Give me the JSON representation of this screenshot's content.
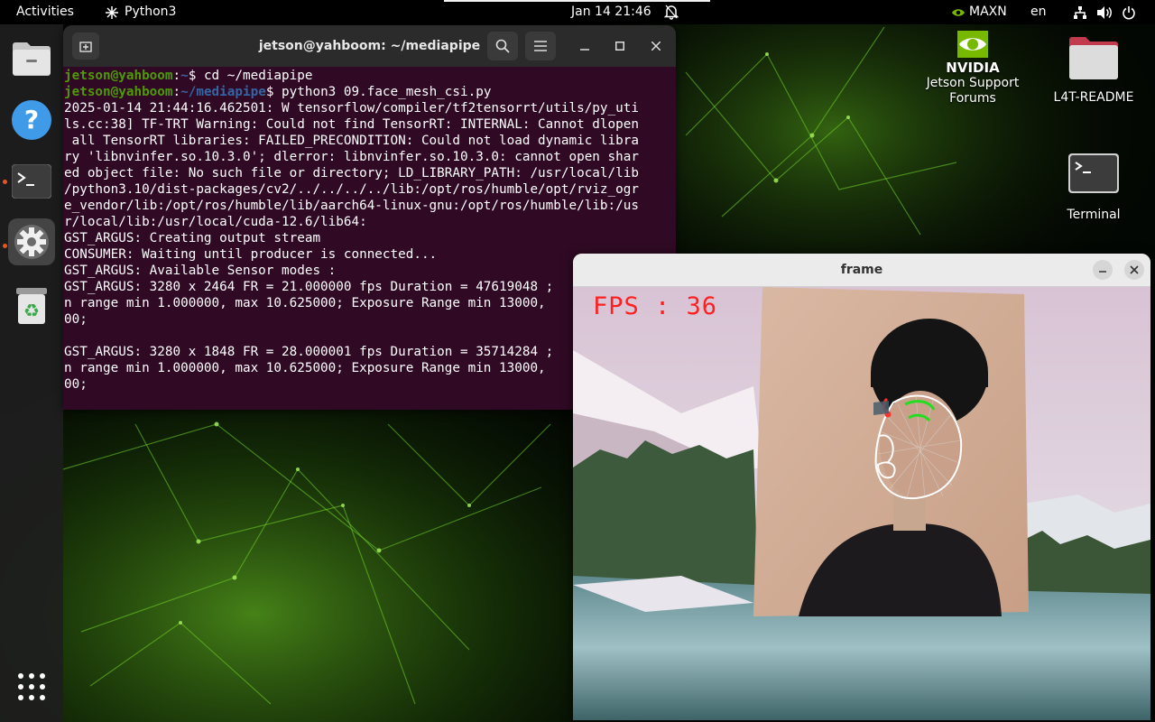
{
  "topbar": {
    "activities": "Activities",
    "app_name": "Python3",
    "clock": "Jan 14  21:46",
    "power_mode": "MAXN",
    "language": "en"
  },
  "dock": {
    "items": [
      {
        "name": "files",
        "icon": "folder-icon"
      },
      {
        "name": "help",
        "icon": "help-icon"
      },
      {
        "name": "terminal",
        "icon": "terminal-icon"
      },
      {
        "name": "settings",
        "icon": "gear-icon"
      },
      {
        "name": "trash",
        "icon": "recycle-icon"
      }
    ],
    "apps_grid_icon": "apps-grid-icon"
  },
  "terminal": {
    "title": "jetson@yahboom: ~/mediapipe",
    "lines": [
      {
        "user": "jetson@yahboom",
        "sep": ":",
        "path": "~",
        "cmd": "$ cd ~/mediapipe"
      },
      {
        "user": "jetson@yahboom",
        "sep": ":",
        "path": "~/mediapipe",
        "cmd": "$ python3 09.face_mesh_csi.py"
      }
    ],
    "output": "2025-01-14 21:44:16.462501: W tensorflow/compiler/tf2tensorrt/utils/py_uti\nls.cc:38] TF-TRT Warning: Could not find TensorRT: INTERNAL: Cannot dlopen\n all TensorRT libraries: FAILED_PRECONDITION: Could not load dynamic libra\nry 'libnvinfer.so.10.3.0'; dlerror: libnvinfer.so.10.3.0: cannot open shar\ned object file: No such file or directory; LD_LIBRARY_PATH: /usr/local/lib\n/python3.10/dist-packages/cv2/../../../../lib:/opt/ros/humble/opt/rviz_ogr\ne_vendor/lib:/opt/ros/humble/lib/aarch64-linux-gnu:/opt/ros/humble/lib:/us\nr/local/lib:/usr/local/cuda-12.6/lib64:\nGST_ARGUS: Creating output stream\nCONSUMER: Waiting until producer is connected...\nGST_ARGUS: Available Sensor modes :\nGST_ARGUS: 3280 x 2464 FR = 21.000000 fps Duration = 47619048 ;\nn range min 1.000000, max 10.625000; Exposure Range min 13000,\n00;\n\nGST_ARGUS: 3280 x 1848 FR = 28.000001 fps Duration = 35714284 ;\nn range min 1.000000, max 10.625000; Exposure Range min 13000,\n00;"
  },
  "desktop": {
    "nvidia_label": "NVIDIA",
    "icons": [
      {
        "label": "Jetson Support\nForums",
        "icon": "nvidia-logo-icon"
      },
      {
        "label": "L4T-README",
        "icon": "folder-icon"
      },
      {
        "label": "Terminal",
        "icon": "terminal-icon"
      }
    ]
  },
  "frame": {
    "title": "frame",
    "fps_text": "FPS : 36"
  },
  "colors": {
    "terminal_bg": "#300a24",
    "prompt_user": "#4e9a06",
    "prompt_path": "#3465a4",
    "accent": "#e95420",
    "fps_text": "#ff2020"
  }
}
